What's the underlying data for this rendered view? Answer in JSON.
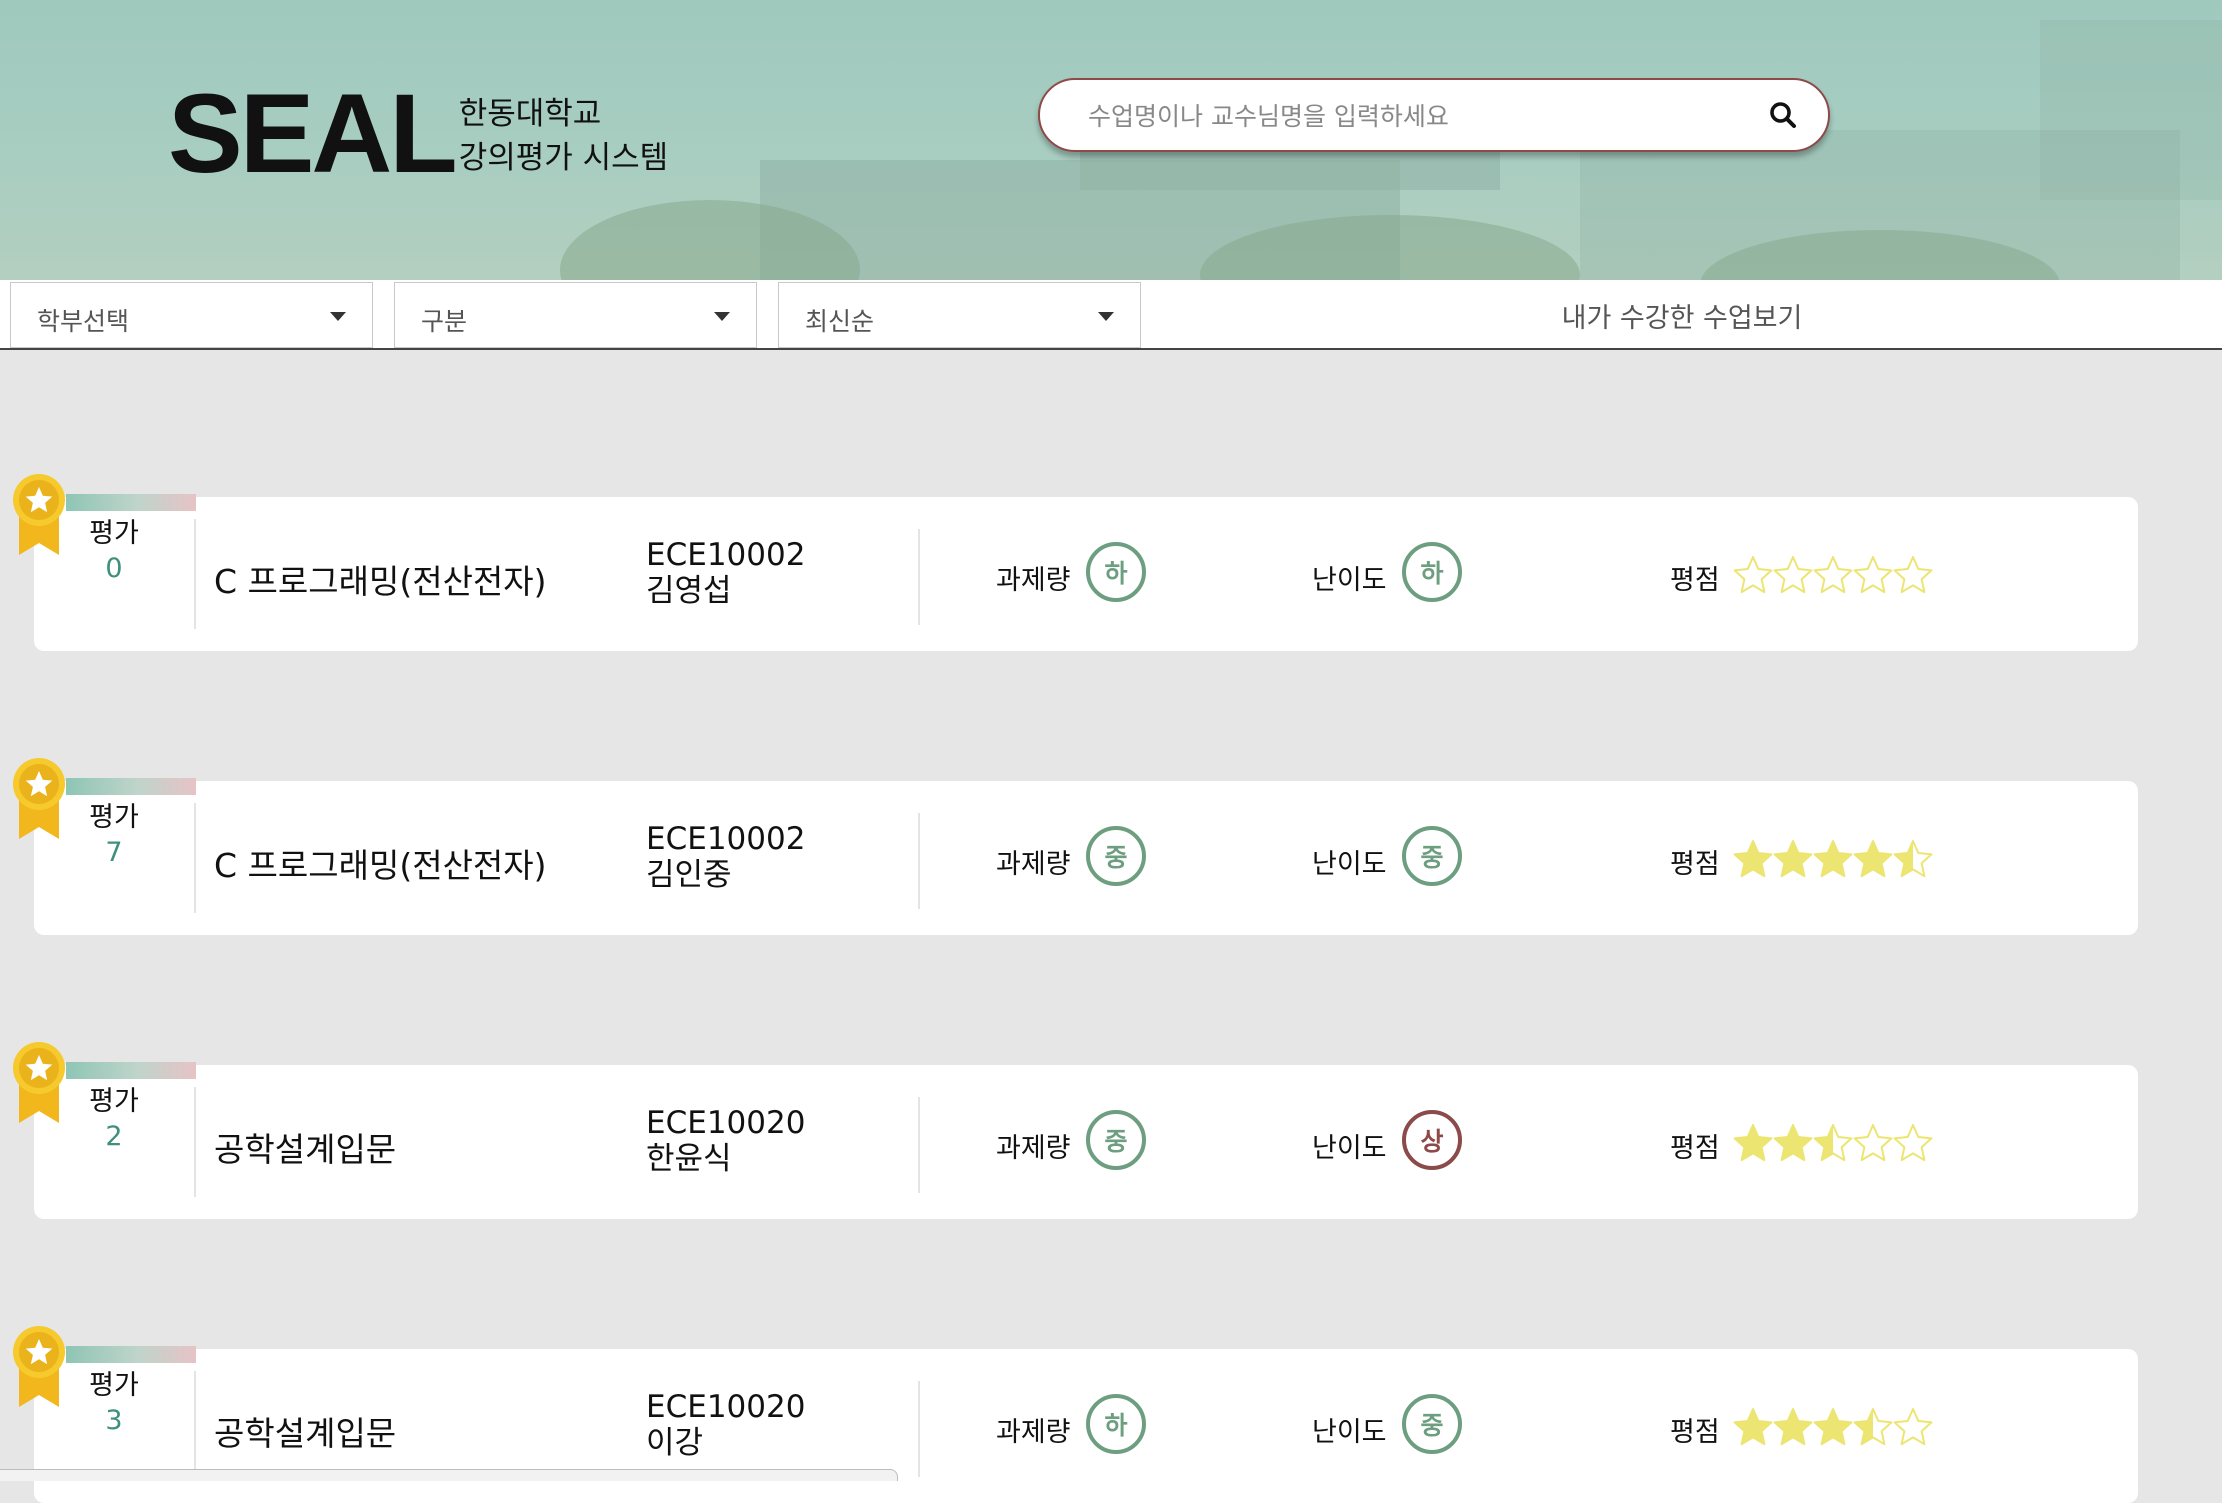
{
  "logo": {
    "title": "SEAL",
    "line1": "한동대학교",
    "line2": "강의평가 시스템"
  },
  "search": {
    "placeholder": "수업명이나 교수님명을 입력하세요",
    "value": ""
  },
  "filters": {
    "department": "학부선택",
    "category": "구분",
    "sort": "최신순",
    "my_courses": "내가 수강한 수업보기"
  },
  "labels": {
    "eval": "평가",
    "workload": "과제량",
    "difficulty": "난이도",
    "rating": "평점"
  },
  "colors": {
    "teal": "#3f8f7e",
    "badge_green": "#6d9e80",
    "badge_red": "#8c4a4a",
    "star": "#ece571"
  },
  "courses": [
    {
      "eval_count": "0",
      "name": "C 프로그래밍(전산전자)",
      "code": "ECE10002",
      "professor": "김영섭",
      "workload": "하",
      "difficulty": "하",
      "rating": 0
    },
    {
      "eval_count": "7",
      "name": "C 프로그래밍(전산전자)",
      "code": "ECE10002",
      "professor": "김인중",
      "workload": "중",
      "difficulty": "중",
      "rating": 4.5
    },
    {
      "eval_count": "2",
      "name": "공학설계입문",
      "code": "ECE10020",
      "professor": "한윤식",
      "workload": "중",
      "difficulty": "상",
      "rating": 2.5
    },
    {
      "eval_count": "3",
      "name": "공학설계입문",
      "code": "ECE10020",
      "professor": "이강",
      "workload": "하",
      "difficulty": "중",
      "rating": 3.5
    }
  ]
}
